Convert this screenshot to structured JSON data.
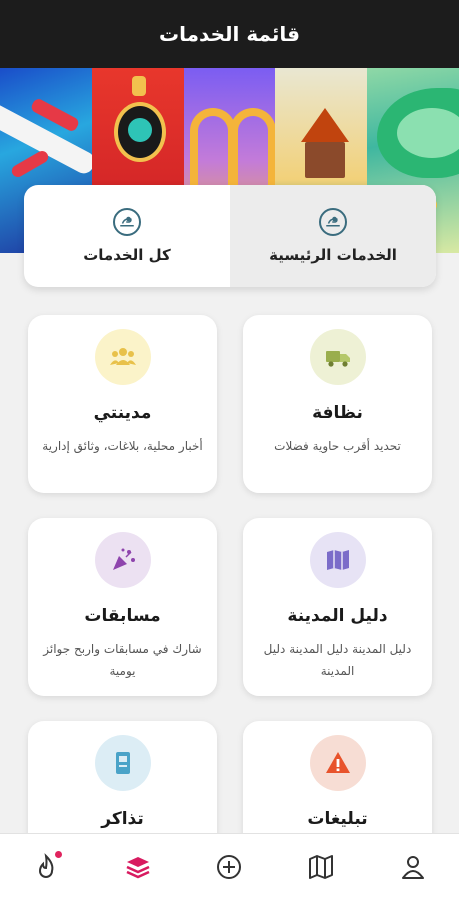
{
  "header": {
    "title": "قائمة الخدمات"
  },
  "tabs": [
    {
      "label": "كل الخدمات",
      "active": false
    },
    {
      "label": "الخدمات الرئيسية",
      "active": true
    }
  ],
  "services": [
    {
      "title": "نظافة",
      "description": "تحديد أقرب حاوية فضلات",
      "icon": "truck-icon",
      "color": "#eef1d5"
    },
    {
      "title": "مدينتي",
      "description": "أخبار محلية، بلاغات، وثائق إدارية",
      "icon": "people-icon",
      "color": "#fbf3c9"
    },
    {
      "title": "دليل المدينة",
      "description": "دليل المدينة دليل المدينة دليل المدينة",
      "icon": "map-icon",
      "color": "#e7e3f5"
    },
    {
      "title": "مسابقات",
      "description": "شارك في مسابقات واربح جوائز يومية",
      "icon": "party-icon",
      "color": "#ece1f2"
    },
    {
      "title": "تبليغات",
      "description": "",
      "icon": "warning-icon",
      "color": "#f7ddd4"
    },
    {
      "title": "تذاكر",
      "description": "",
      "icon": "ticket-icon",
      "color": "#dcedf5"
    }
  ],
  "nav": {
    "items": [
      "user-icon",
      "map-icon",
      "plus-circle-icon",
      "layers-icon",
      "flame-icon"
    ],
    "active": "layers-icon",
    "accent": "#d81b60"
  }
}
